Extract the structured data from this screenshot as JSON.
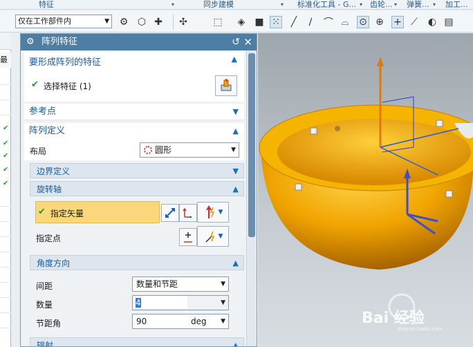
{
  "ribbon": {
    "groups": [
      "特征",
      "同步建模",
      "标准化工具 - G...",
      "齿轮...",
      "弹簧...",
      "加工..."
    ]
  },
  "toolbar": {
    "filter_value": "仅在工作部件内",
    "icons": [
      "feature-icon",
      "shell-icon",
      "move-icon",
      "snap-icon",
      "select-box-icon",
      "solid-icon",
      "cube-icon",
      "point-grid-icon",
      "line-icon",
      "curve-icon",
      "bend-icon",
      "arc-icon",
      "center-point-icon",
      "quadrant-icon",
      "cross-icon",
      "tangent-icon",
      "intersect-icon",
      "layer-icon"
    ]
  },
  "left_strip": {
    "header_label": "最新"
  },
  "dialog": {
    "title": "阵列特征",
    "sections": {
      "features_to_pattern": {
        "title": "要形成阵列的特征",
        "select_label": "选择特征 (1)"
      },
      "reference_point": {
        "title": "参考点"
      },
      "pattern_definition": {
        "title": "阵列定义",
        "layout_label": "布局",
        "layout_value": "圆形",
        "boundary_definition": {
          "title": "边界定义"
        },
        "rotation_axis": {
          "title": "旋转轴",
          "specify_vector_label": "指定矢量",
          "specify_point_label": "指定点"
        },
        "angle_direction": {
          "title": "角度方向",
          "spacing_label": "间距",
          "spacing_value": "数量和节距",
          "count_label": "数量",
          "count_value": "4",
          "pitch_angle_label": "节距角",
          "pitch_angle_value": "90",
          "pitch_angle_unit": "deg"
        },
        "radiate": {
          "title": "辐射"
        }
      }
    }
  },
  "watermark": {
    "text": "Bai 经验",
    "subtext": "jingyan.baidu.com"
  },
  "colors": {
    "dialog_title_bar": "#4e7ea3",
    "section_title": "#1a5a9a",
    "highlight_row": "#f9d77a",
    "part_orange": "#f0a400",
    "check_green": "#1e9c2e"
  }
}
